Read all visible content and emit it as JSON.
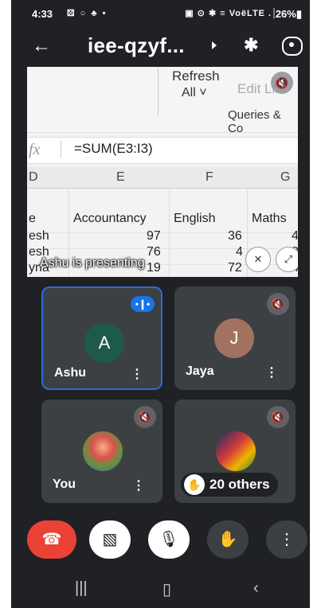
{
  "status": {
    "time": "4:33",
    "left_icons": "⚄ ○ ♣ •",
    "right_icons": "▣ ⊙ ✱ ≡ VoëLTE .│",
    "battery": "26%▮"
  },
  "header": {
    "back_glyph": "←",
    "meeting_code": "iee-qzyf...",
    "bluetooth_glyph": "✱"
  },
  "presentation": {
    "ribbon": {
      "refresh": "Refresh",
      "all": "All ˅",
      "edit": "Edit Lin",
      "queries": "Queries & Co"
    },
    "fx_label": "fx",
    "formula": "=SUM(E3:I3)",
    "columns": [
      "D",
      "E",
      "F",
      "G"
    ],
    "headers": [
      "e",
      "Accountancy",
      "English",
      "Maths"
    ],
    "rows": [
      [
        "esh",
        "97",
        "36",
        "4"
      ],
      [
        "esh",
        "76",
        "4",
        "8"
      ],
      [
        "yna",
        "19",
        "72",
        "4"
      ]
    ],
    "presenting_label": "Ashu is presenting"
  },
  "participants": [
    {
      "name": "Ashu",
      "initial": "A",
      "avatar_color": "#1e5a4a"
    },
    {
      "name": "Jaya",
      "initial": "J",
      "avatar_color": "#a1725f"
    },
    {
      "name": "You"
    },
    {
      "others": "20 others"
    }
  ],
  "menu_glyph": "⋮",
  "controls": {
    "end_glyph": "☎",
    "camera_glyph": "▧",
    "mic_glyph": "🎙",
    "hand_glyph": "✋",
    "more_glyph": "⋮"
  },
  "nav": {
    "recent": "|||",
    "home": "▯",
    "back": "‹"
  }
}
